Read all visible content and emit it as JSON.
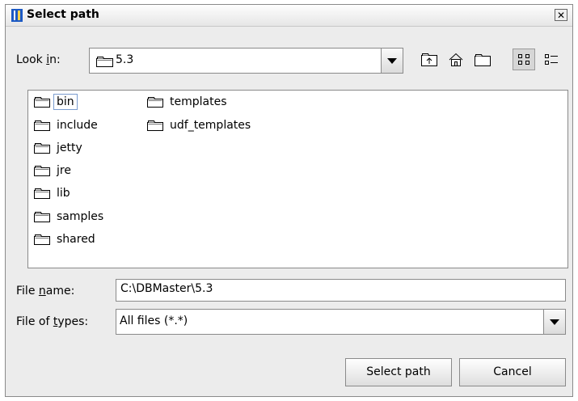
{
  "window": {
    "title": "Select path",
    "close_glyph": "✕"
  },
  "look_in": {
    "label_before": "Look ",
    "label_mnemonic": "i",
    "label_after": "n:",
    "value": "5.3"
  },
  "toolbar": {
    "buttons": [
      {
        "name": "up-one-level-icon"
      },
      {
        "name": "home-icon"
      },
      {
        "name": "new-folder-icon"
      },
      {
        "name": "list-view-icon",
        "selected": true
      },
      {
        "name": "details-view-icon"
      }
    ]
  },
  "files": {
    "col1": [
      "bin",
      "include",
      "jetty",
      "jre",
      "lib",
      "samples",
      "shared"
    ],
    "col2": [
      "templates",
      "udf_templates"
    ]
  },
  "file_name": {
    "label_before": "File ",
    "label_mnemonic": "n",
    "label_after": "ame:",
    "value": "C:\\DBMaster\\5.3"
  },
  "file_types": {
    "label_before": "File of ",
    "label_mnemonic": "t",
    "label_after": "ypes:",
    "value": "All files (*.*)"
  },
  "buttons": {
    "select_label": "Select path",
    "cancel_label": "Cancel"
  }
}
